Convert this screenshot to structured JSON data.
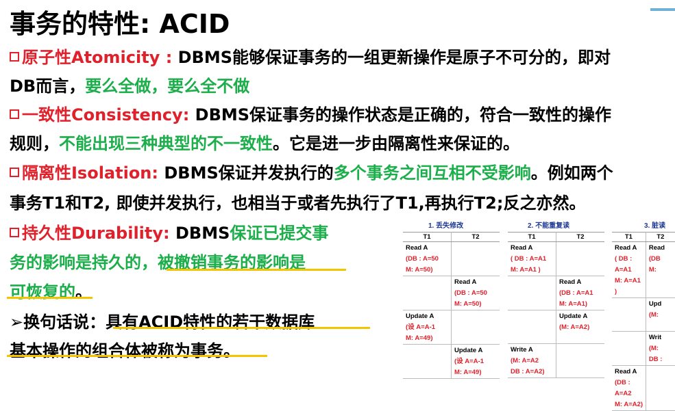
{
  "title": "事务的特性: ACID",
  "atomicity": {
    "label": "原子性Atomicity :",
    "text1": " DBMS能够保证事务的一组更新操作是原子不可分的，即对",
    "text2": "DB而言，",
    "green": "要么全做，要么全不做"
  },
  "consistency": {
    "label": "一致性Consistency:",
    "text1": " DBMS保证事务的操作状态是正确的，符合一致性的操作",
    "text2": "规则，",
    "green": "不能出现三种典型的不一致性",
    "text3": "。它是进一步由隔离性来保证的。"
  },
  "isolation": {
    "label": "隔离性Isolation:",
    "text1": " DBMS保证并发执行的",
    "green": "多个事务之间互相不受影响",
    "text2": "。例如两个",
    "text3": "事务T1和T2, 即使并发执行，也相当于或者先执行了T1,再执行T2;反之亦然。"
  },
  "durability": {
    "label": "持久性Durability:",
    "text1": " DBMS",
    "green1": "保证已提交事",
    "green2": "务的影响是持久的，被撤销事务的影响是",
    "green3": "可恢复的",
    "text2": "。"
  },
  "summary": {
    "line1": "➢换句话说：具有ACID特性的若干数据库",
    "line2": "基本操作的组合体被称为事务。"
  },
  "tables": [
    {
      "caption": "1. 丢失修改",
      "headers": [
        "T1",
        "T2"
      ],
      "rows": [
        [
          [
            "Read A",
            "(DB : A=50",
            "M: A=50)"
          ],
          []
        ],
        [
          [],
          [
            "Read A",
            "(DB : A=50",
            "M: A=50)"
          ]
        ],
        [
          [
            "Update A",
            "(设 A=A-1",
            "M: A=49)"
          ],
          []
        ],
        [
          [],
          [
            "Update A",
            "(设 A=A-1",
            "M: A=49)"
          ]
        ]
      ]
    },
    {
      "caption": "2. 不能重复读",
      "headers": [
        "T1",
        "T2"
      ],
      "rows": [
        [
          [
            "Read A",
            "( DB : A=A1",
            "M: A=A1 )"
          ],
          []
        ],
        [
          [],
          [
            "Read A",
            "(DB : A=A1",
            "M: A=A1)"
          ]
        ],
        [
          [],
          [
            "Update A",
            "(M: A=A2)"
          ]
        ],
        [
          [
            "Write A",
            "(M: A=A2",
            "DB : A=A2)"
          ],
          []
        ]
      ]
    },
    {
      "caption": "3. 脏读",
      "headers": [
        "T1",
        "T2"
      ],
      "rows": [
        [
          [
            "Read A",
            "( DB : A=A1",
            "M: A=A1 )"
          ],
          [
            "Read",
            "(DB",
            "M:"
          ]
        ],
        [
          [],
          [
            "Upd",
            "(M:"
          ]
        ],
        [
          [],
          [
            "Writ",
            "(M:",
            "DB :"
          ]
        ],
        [
          [
            "Read A",
            "(DB : A=A2",
            "M: A=A2)"
          ],
          []
        ]
      ]
    }
  ]
}
